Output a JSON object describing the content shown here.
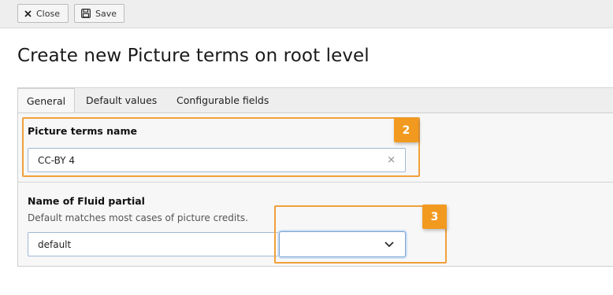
{
  "toolbar": {
    "close_label": "Close",
    "save_label": "Save"
  },
  "page": {
    "title": "Create new Picture terms on root level"
  },
  "tabs": [
    {
      "label": "General",
      "active": true
    },
    {
      "label": "Default values",
      "active": false
    },
    {
      "label": "Configurable fields",
      "active": false
    }
  ],
  "fields": {
    "picture_terms_name": {
      "label": "Picture terms name",
      "value": "CC-BY 4"
    },
    "fluid_partial": {
      "label": "Name of Fluid partial",
      "description": "Default matches most cases of picture credits.",
      "value": "default",
      "select_value": ""
    }
  },
  "callouts": [
    {
      "number": "2"
    },
    {
      "number": "3"
    }
  ],
  "colors": {
    "callout": "#f29a1f",
    "highlight_border": "#f0a03a",
    "toolbar_bg": "#eeeeee",
    "panel_bg": "#f7f7f7",
    "input_border": "#9fb8d3"
  },
  "icons": {
    "close": "close-icon",
    "save": "save-icon",
    "clear": "clear-icon",
    "dropdown": "chevron-down-icon"
  }
}
